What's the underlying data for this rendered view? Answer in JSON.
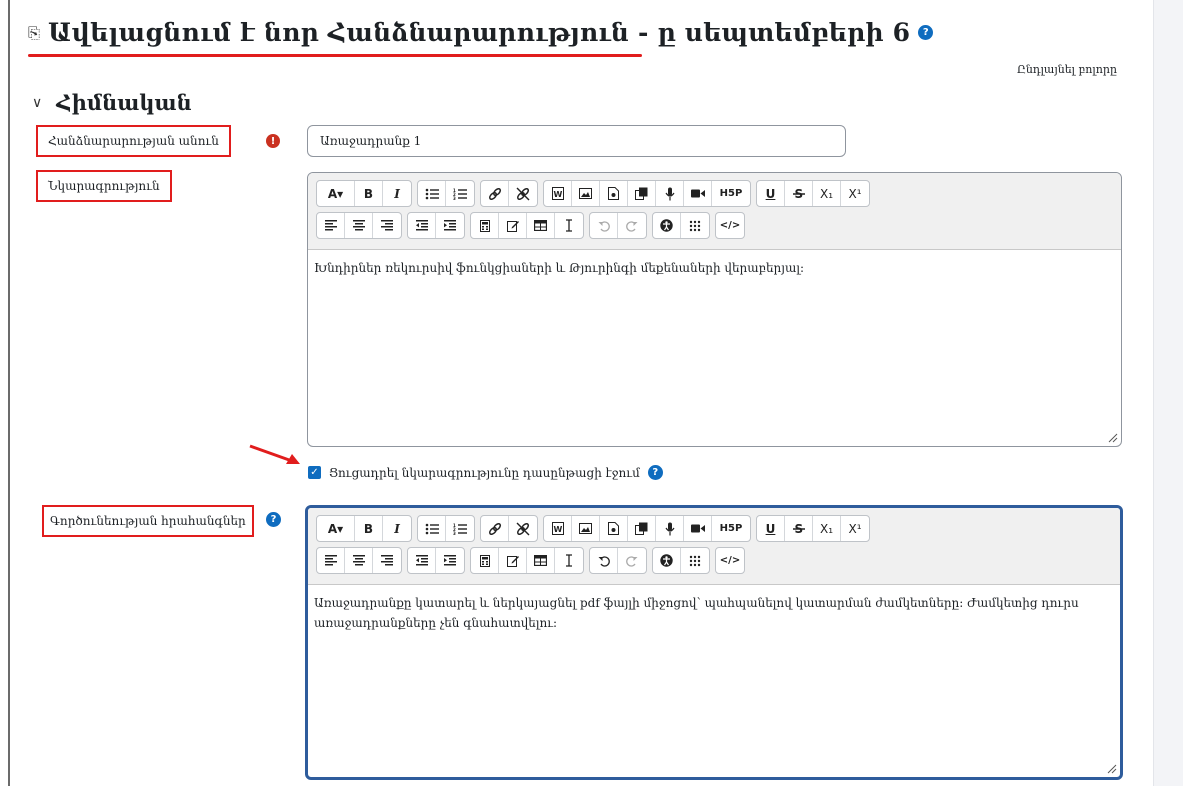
{
  "page": {
    "title": "Ավելացնում է նոր Հանձնարարություն - ը սեպտեմբերի 6",
    "help_glyph": "?",
    "expand_all": "Ընդլայնել բոլորը",
    "accent_color": "#0f6cbf",
    "highlight_color": "#e11d1d"
  },
  "section": {
    "title": "Հիմնական"
  },
  "fields": {
    "name_label": "Հանձնարարության անուն",
    "name_required_glyph": "!",
    "name_value": "Առաջադրանք 1",
    "description_label": "Նկարագրություն",
    "activity_label": "Գործունեության հրահանգներ"
  },
  "toolbar": {
    "bold": "B",
    "italic": "I",
    "subscript": "X₁",
    "superscript": "X¹",
    "underline": "U",
    "h5p": "H5P",
    "font_size": "A▾",
    "code": "</>"
  },
  "editors": {
    "description_text": "Խնդիրներ ռեկուրսիվ ֆունկցիաների և Թյուրինգի մեքենաների վերաբերյալ:",
    "activity_text": "Առաջադրանքը կատարել և ներկայացնել pdf ֆայլի միջոցով՝ պահպանելով կատարման ժամկետները: Ժամկետից դուրս առաջադրանքները չեն գնահատվելու:"
  },
  "checkbox": {
    "label": "Ցուցադրել նկարագրությունը դասընթացի էջում",
    "checked": true,
    "check_glyph": "✓"
  }
}
